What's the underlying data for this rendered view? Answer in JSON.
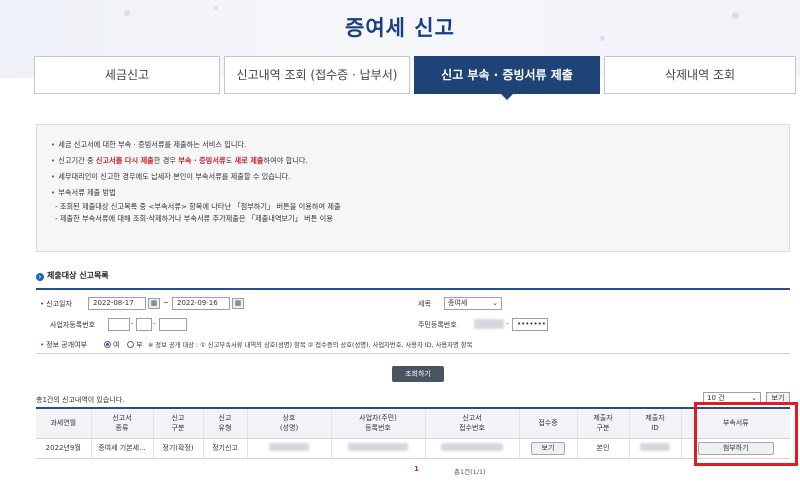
{
  "page": {
    "title": "증여세 신고"
  },
  "tabs": [
    {
      "label": "세금신고",
      "active": false
    },
    {
      "label": "신고내역 조회 (접수증 · 납부서)",
      "active": false
    },
    {
      "label": "신고 부속 · 증빙서류 제출",
      "active": true
    },
    {
      "label": "삭제내역 조회",
      "active": false
    }
  ],
  "info": {
    "line1": "세금 신고서에 대한 부속 · 증빙서류를 제출하는 서비스 입니다.",
    "line2_a": "신고기간 중 ",
    "line2_b": "신고서를 다시 제출",
    "line2_c": "한 경우 ",
    "line2_d": "부속 · 증빙서류",
    "line2_e": "도 ",
    "line2_f": "새로 제출",
    "line2_g": "하여야 합니다.",
    "line3": "세무대리인이 신고한 경우에도 납세자 본인이 부속서류를 제출할 수 있습니다.",
    "line4": "부속서류 제출 방법",
    "sub1": "- 조회된 제출대상 신고목록 중 <부속서류> 항목에 나타난 「첨부하기」 버튼을 이용하여 제출",
    "sub2": "- 제출한 부속서류에 대해 조회·삭제하거나 부속서류 추가제출은 「제출내역보기」 버튼 이용"
  },
  "section": {
    "title": "제출대상 신고목록"
  },
  "form": {
    "date_label": "신고일자",
    "date_from": "2022-08-17",
    "date_to": "2022-09-16",
    "tilde": "~",
    "tax_label": "세목",
    "tax_value": "증여세",
    "bizno_label": "사업자등록번호",
    "rrn_label": "주민등록번호",
    "rrn_masked": "•••••••",
    "dash": "-",
    "disclosure_label": "정보 공개여부",
    "yes": "여",
    "no": "부",
    "disclosure_note": "※ 정보 공개 대상 : ① 신고부속서류 내역의 상호(성명) 항목 ② 접수증의 상호(성명), 사업자번호, 사용자 ID, 사용자명 항목",
    "search_button": "조회하기"
  },
  "list": {
    "count_text": "총1건의 신고내역이 있습니다.",
    "page_size": "10 건",
    "view_button": "보기",
    "headers": [
      "과세연월",
      "신고서\n종류",
      "신고\n구분",
      "신고\n유형",
      "상호\n(성명)",
      "사업자(주민)\n등록번호",
      "신고서\n접수번호",
      "접수증",
      "제출자\n구분",
      "제출자\nID",
      "부속서류"
    ],
    "rows": [
      {
        "period": "2022년9월",
        "form_type": "증여세 기본세...",
        "category": "정기(확정)",
        "type": "정기신고",
        "receipt_button": "보기",
        "submitter": "본인",
        "attach_button": "첨부하기"
      }
    ]
  },
  "pager": {
    "current": "1",
    "total": "총1건(1/1)"
  }
}
